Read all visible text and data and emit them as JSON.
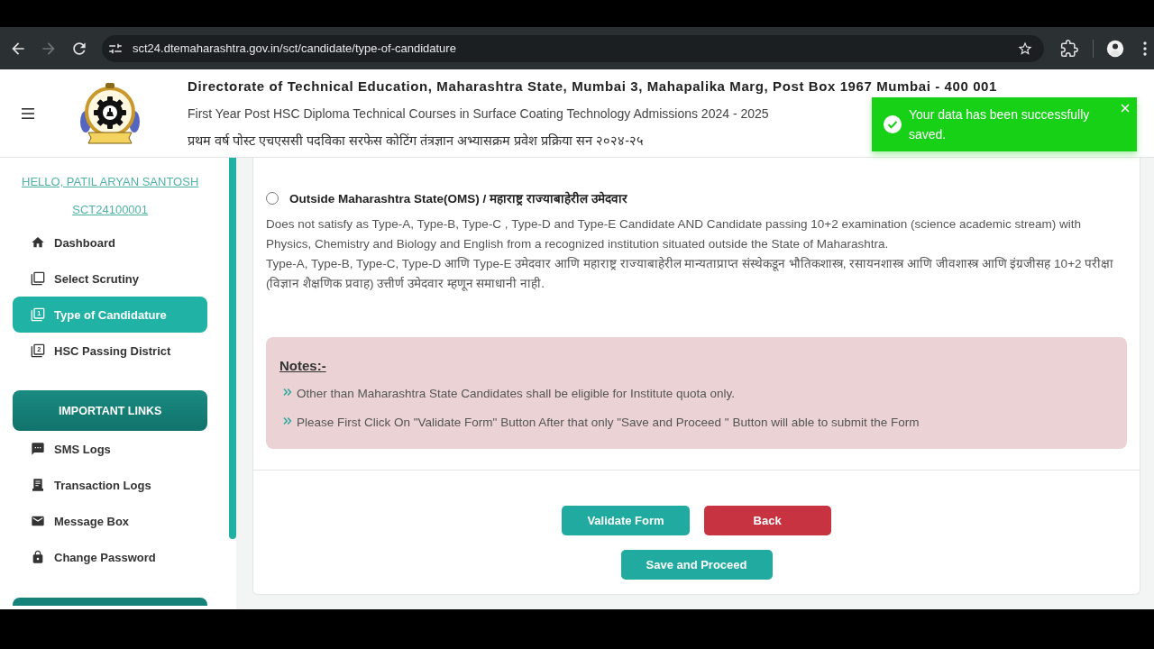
{
  "browser": {
    "url": "sct24.dtemaharashtra.gov.in/sct/candidate/type-of-candidature",
    "forward_disabled": true
  },
  "header": {
    "title": "Directorate of Technical Education, Maharashtra State, Mumbai 3, Mahapalika Marg, Post Box 1967 Mumbai - 400 001",
    "subtitle": "First Year Post HSC Diploma Technical Courses in Surface Coating Technology Admissions 2024 - 2025",
    "subtitle_marathi": "प्रथम वर्ष पोस्ट एचएससी पदविका सरफेस कोटिंग तंत्रज्ञान अभ्यासक्रम प्रवेश प्रक्रिया सन २०२४-२५"
  },
  "toast": {
    "message": "Your data has been successfully saved."
  },
  "sidebar": {
    "greeting": "HELLO, PATIL ARYAN SANTOSH",
    "candidate_id": "SCT24100001",
    "items": [
      {
        "label": "Dashboard",
        "kind": "home",
        "selected": false
      },
      {
        "label": "Select Scrutiny",
        "kind": "stack",
        "selected": false
      },
      {
        "label": "Type of Candidature",
        "kind": "numbered",
        "number": "1",
        "selected": true
      },
      {
        "label": "HSC Passing District",
        "kind": "numbered",
        "number": "2",
        "selected": false
      }
    ],
    "links_title": "IMPORTANT LINKS",
    "links": [
      {
        "label": "SMS Logs",
        "kind": "chat",
        "selected": false
      },
      {
        "label": "Transaction Logs",
        "kind": "receipt",
        "selected": false
      },
      {
        "label": "Message Box",
        "kind": "mail",
        "selected": false
      },
      {
        "label": "Change Password",
        "kind": "lock",
        "selected": false
      }
    ]
  },
  "option": {
    "label": "Outside Maharashtra State(OMS) / महाराष्ट्र राज्याबाहेरील उमेदवार",
    "selected": false,
    "description": "Does not satisfy as Type-A, Type-B, Type-C , Type-D and Type-E Candidate AND Candidate passing 10+2 examination (science academic stream) with Physics, Chemistry and Biology and English from a recognized institution situated outside the State of Maharashtra.",
    "description_marathi": "Type-A, Type-B, Type-C, Type-D आणि Type-E उमेदवार आणि महाराष्ट्र राज्याबाहेरील मान्यताप्राप्त संस्थेकडून भौतिकशास्त्र, रसायनशास्त्र आणि जीवशास्त्र आणि इंग्रजीसह 10+2 परीक्षा (विज्ञान शैक्षणिक प्रवाह) उत्तीर्ण उमेदवार म्हणून समाधानी नाही."
  },
  "notes": {
    "title": "Notes:-",
    "items": [
      "Other than Maharashtra State Candidates shall be eligible for Institute quota only.",
      "Please First Click On \"Validate Form\" Button After that only \"Save and Proceed \" Button will able to submit the Form"
    ]
  },
  "button_rows": [
    [
      {
        "label": "Validate Form",
        "kind": "primary"
      },
      {
        "label": "Back",
        "kind": "danger"
      }
    ],
    [
      {
        "label": "Save and Proceed",
        "kind": "primary"
      }
    ]
  ]
}
